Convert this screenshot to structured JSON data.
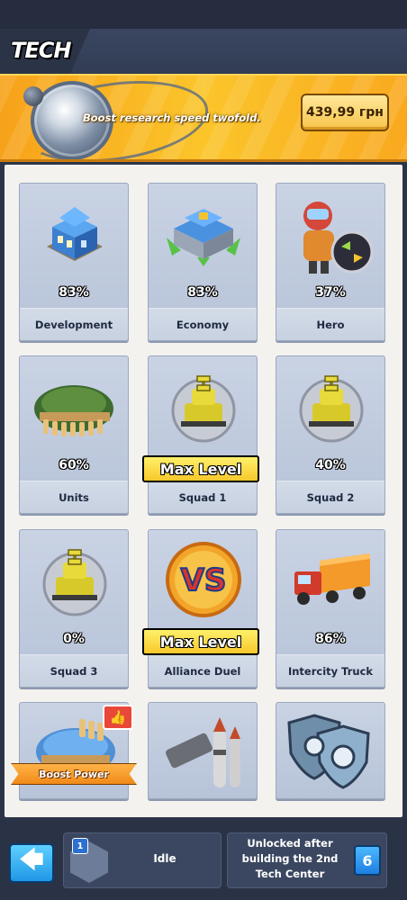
{
  "header": {
    "title": "TECH"
  },
  "banner": {
    "text": "Boost research speed twofold.",
    "price": "439,99 грн"
  },
  "tech_cards": [
    {
      "label": "Development",
      "percent": "83%",
      "icon": "blue-building-icon"
    },
    {
      "label": "Economy",
      "percent": "83%",
      "icon": "economy-building-icon"
    },
    {
      "label": "Hero",
      "percent": "37%",
      "icon": "hero-icon"
    },
    {
      "label": "Units",
      "percent": "60%",
      "icon": "helmet-icon"
    },
    {
      "label": "Squad 1",
      "badge": "Max Level",
      "icon": "tank-squad-icon"
    },
    {
      "label": "Squad 2",
      "percent": "40%",
      "icon": "tank-squad-icon"
    },
    {
      "label": "Squad 3",
      "percent": "0%",
      "icon": "tank-squad-icon"
    },
    {
      "label": "Alliance Duel",
      "badge": "Max Level",
      "icon": "vs-icon"
    },
    {
      "label": "Intercity Truck",
      "percent": "86%",
      "icon": "truck-icon"
    },
    {
      "ribbon": "Boost Power",
      "icon": "helmet-icon"
    },
    {
      "icon": "missiles-icon"
    },
    {
      "icon": "shield-gear-icon"
    }
  ],
  "bottom": {
    "queue_number": "1",
    "queue_status": "Idle",
    "unlock_text": "Unlocked after building the 2nd Tech Center",
    "lock_number": "6"
  },
  "colors": {
    "accent_banner": "#fbc52a",
    "max_level": "#f7c82a",
    "back_button": "#1f97e6"
  }
}
